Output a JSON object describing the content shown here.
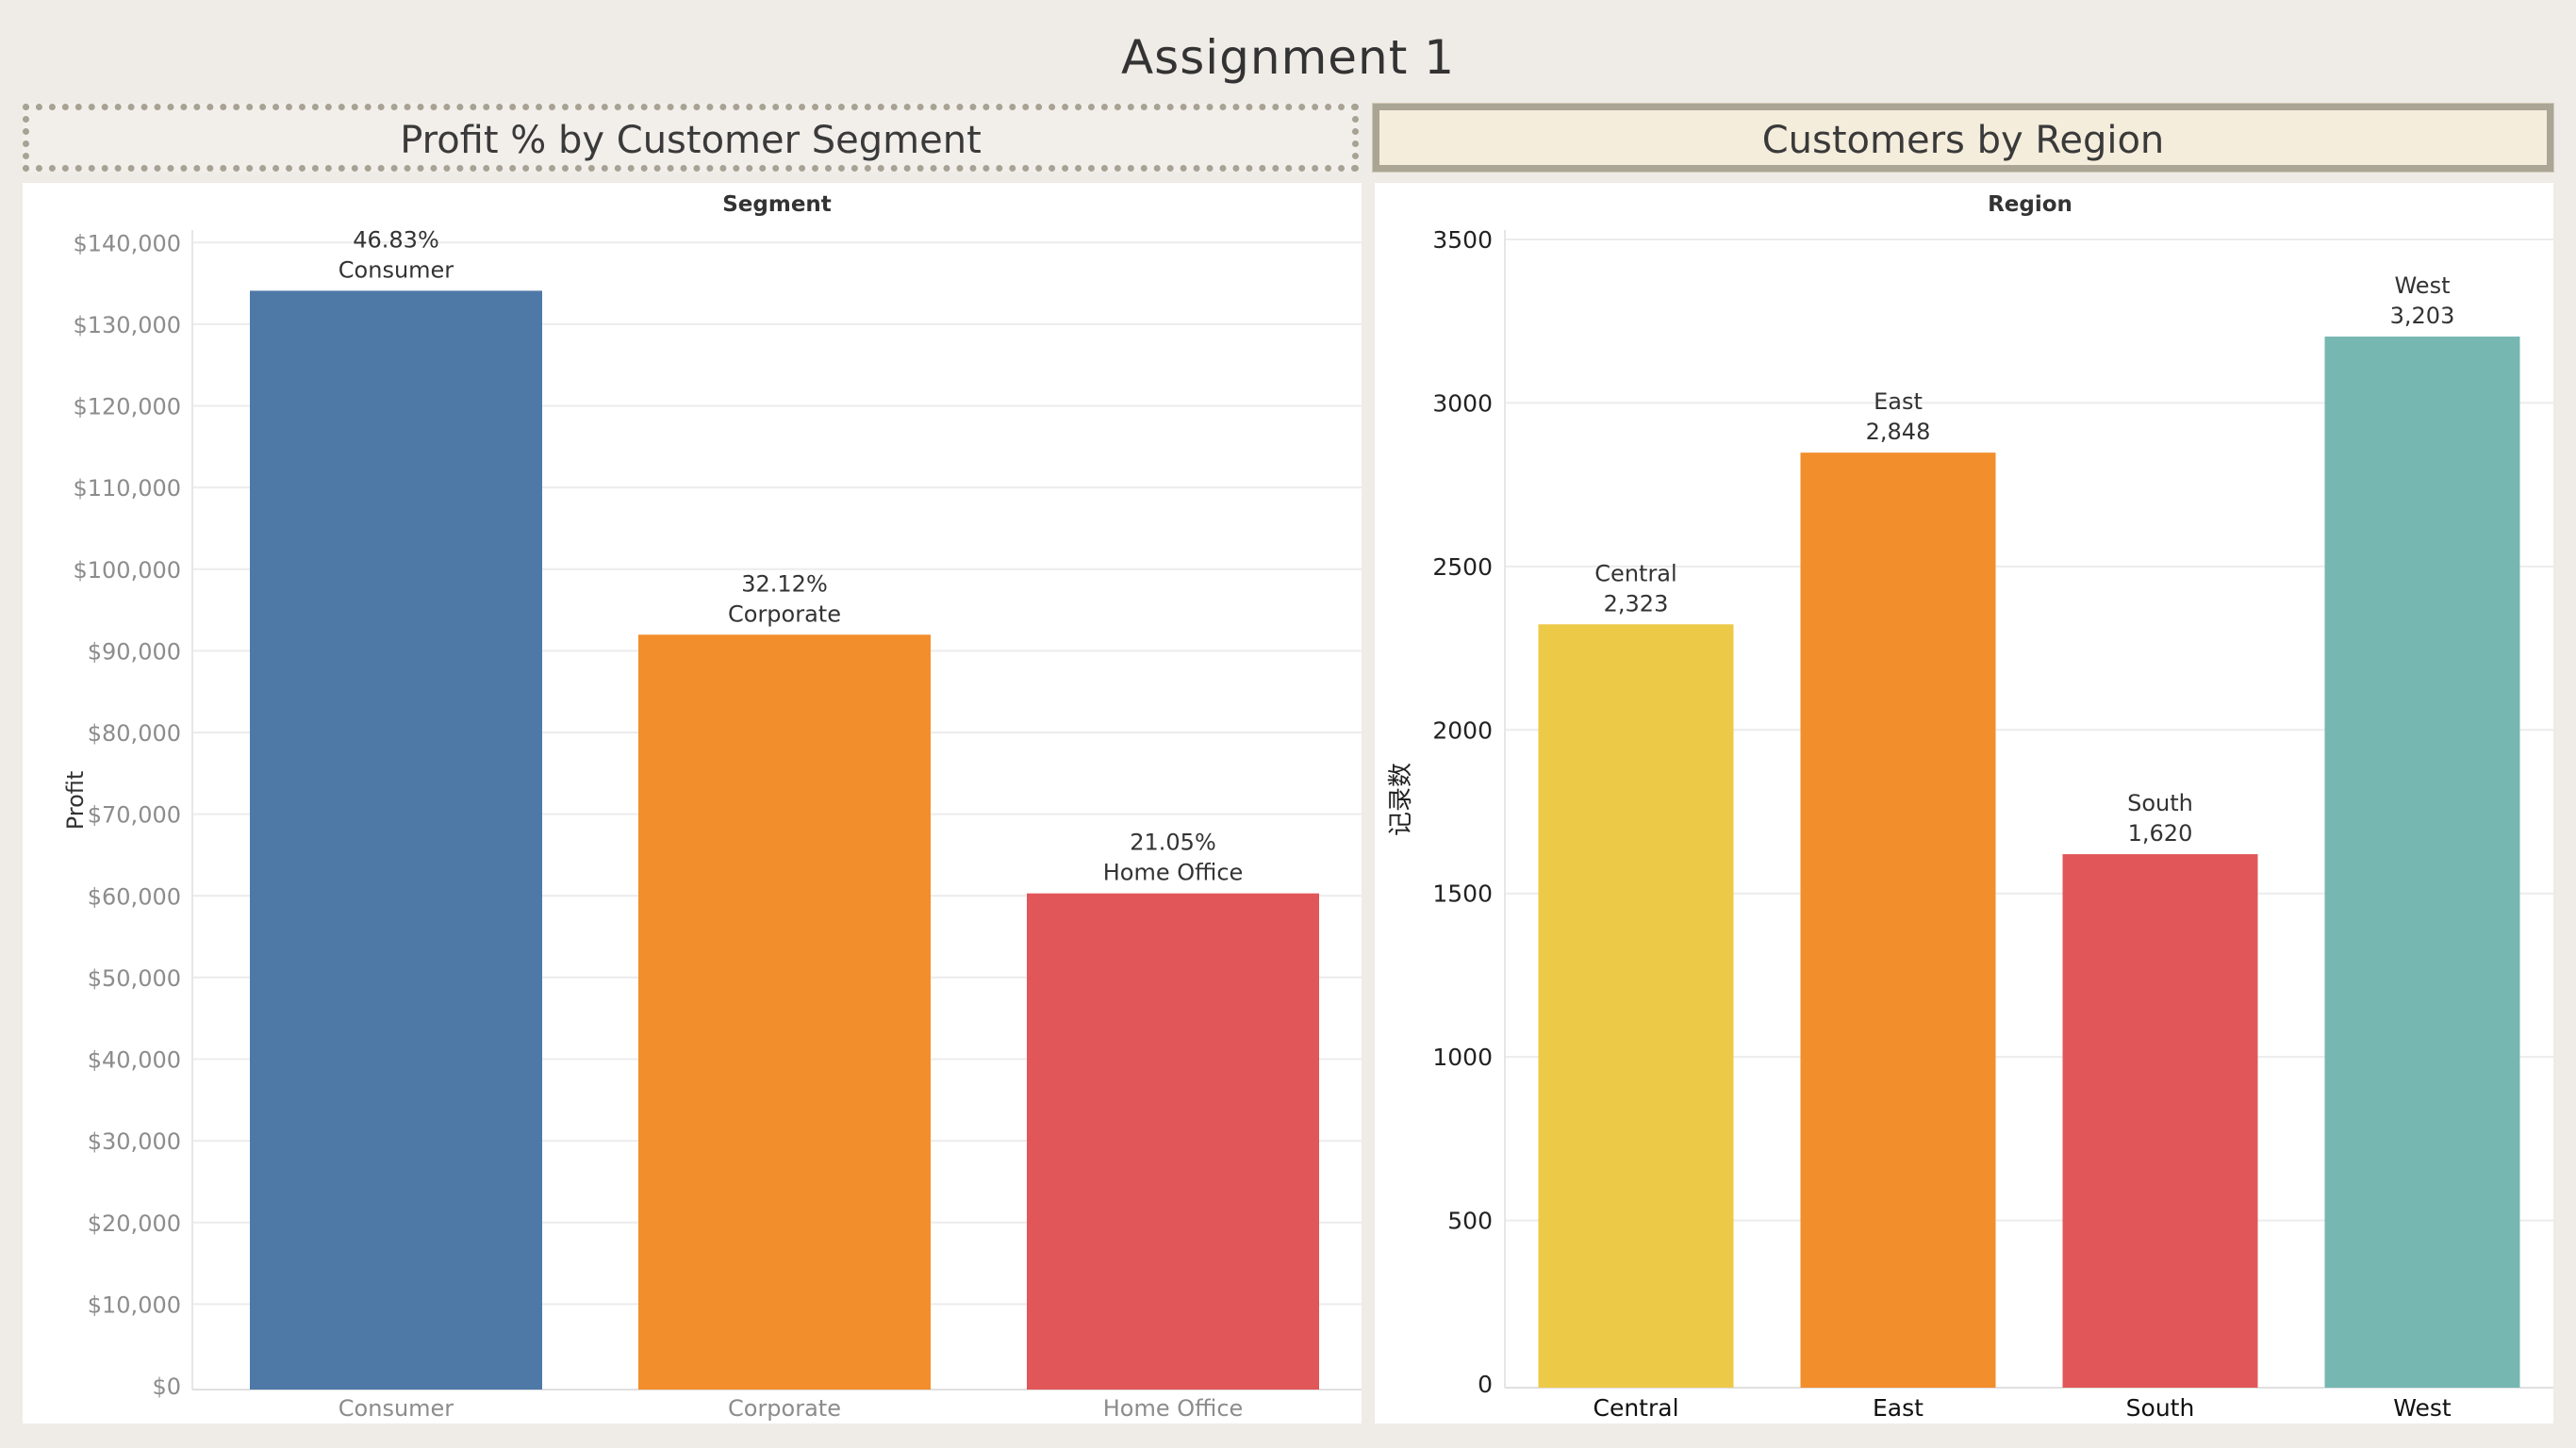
{
  "title": "Assignment 1",
  "left_panel": {
    "header": "Profit % by Customer Segment"
  },
  "right_panel": {
    "header": "Customers by Region"
  },
  "chart_data": [
    {
      "type": "bar",
      "top_label": "Segment",
      "ylabel": "Profit",
      "categories": [
        "Consumer",
        "Corporate",
        "Home Office"
      ],
      "values": [
        134100,
        91980,
        60300
      ],
      "percent_labels": [
        "46.83%",
        "32.12%",
        "21.05%"
      ],
      "colors": [
        "#4e79a7",
        "#f28e2b",
        "#e15759"
      ],
      "ylim": [
        0,
        145000
      ],
      "yticks": [
        0,
        10000,
        20000,
        30000,
        40000,
        50000,
        60000,
        70000,
        80000,
        90000,
        100000,
        110000,
        120000,
        130000,
        140000
      ],
      "ytick_labels": [
        "$0",
        "$10,000",
        "$20,000",
        "$30,000",
        "$40,000",
        "$50,000",
        "$60,000",
        "$70,000",
        "$80,000",
        "$90,000",
        "$100,000",
        "$110,000",
        "$120,000",
        "$130,000",
        "$140,000"
      ],
      "grid": true
    },
    {
      "type": "bar",
      "top_label": "Region",
      "ylabel": "记录数",
      "categories": [
        "Central",
        "East",
        "South",
        "West"
      ],
      "values": [
        2323,
        2848,
        1620,
        3203
      ],
      "value_labels": [
        "2,323",
        "2,848",
        "1,620",
        "3,203"
      ],
      "colors": [
        "#edc948",
        "#f28e2b",
        "#e15759",
        "#76b7b2"
      ],
      "ylim": [
        0,
        3500
      ],
      "yticks": [
        0,
        500,
        1000,
        1500,
        2000,
        2500,
        3000,
        3500
      ],
      "ytick_labels": [
        "0",
        "500",
        "1000",
        "1500",
        "2000",
        "2500",
        "3000",
        "3500"
      ],
      "grid": true
    }
  ]
}
